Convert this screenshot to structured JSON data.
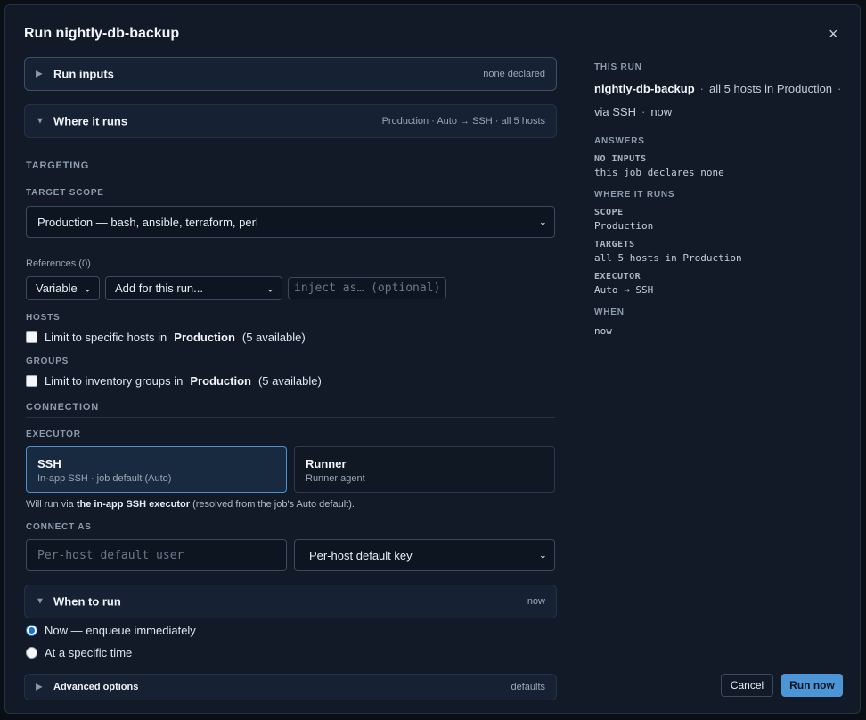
{
  "modal": {
    "title": "Run nightly-db-backup",
    "close_icon": "×"
  },
  "sections": {
    "run_inputs": {
      "label": "Run inputs",
      "meta": "none declared",
      "arrow": "▶"
    },
    "where_it_runs": {
      "label": "Where it runs",
      "meta": "Production · Auto → SSH · all 5 hosts",
      "arrow": "▼"
    },
    "when_to_run": {
      "label": "When to run",
      "meta": "now",
      "arrow": "▼"
    },
    "advanced": {
      "label": "Advanced options",
      "meta": "defaults",
      "arrow": "▶"
    }
  },
  "targeting": {
    "heading": "TARGETING",
    "scope_label": "TARGET SCOPE",
    "scope_value": "Production — bash, ansible, terraform, perl",
    "references_label": "References (0)",
    "ref_type": "Variable",
    "ref_add": "Add for this run...",
    "inject_placeholder": "inject as… (optional)",
    "hosts_label": "HOSTS",
    "hosts_check_prefix": "Limit to specific hosts in",
    "hosts_env": "Production",
    "hosts_count": "(5 available)",
    "groups_label": "GROUPS",
    "groups_check_prefix": "Limit to inventory groups in",
    "groups_env": "Production",
    "groups_count": "(5 available)"
  },
  "connection": {
    "heading": "CONNECTION",
    "executor_label": "EXECUTOR",
    "executors": [
      {
        "title": "SSH",
        "subtitle": "In-app SSH · job default (Auto)"
      },
      {
        "title": "Runner",
        "subtitle": "Runner agent"
      }
    ],
    "note_prefix": "Will run via",
    "note_bold": "the in-app SSH executor",
    "note_suffix": "(resolved from the job's Auto default).",
    "connect_as_label": "CONNECT AS",
    "user_placeholder": "Per-host default user",
    "key_value": "Per-host default key"
  },
  "when": {
    "options": [
      {
        "label": "Now — enqueue immediately",
        "selected": true
      },
      {
        "label": "At a specific time",
        "selected": false
      }
    ]
  },
  "summary": {
    "this_run_label": "THIS RUN",
    "job": "nightly-db-backup",
    "hosts_desc": "all 5 hosts in Production",
    "via": "via SSH",
    "when": "now",
    "sep": "·",
    "answers_label": "ANSWERS",
    "no_inputs_key": "NO INPUTS",
    "no_inputs_val": "this job declares none",
    "where_label": "WHERE IT RUNS",
    "scope_key": "SCOPE",
    "scope_val": "Production",
    "targets_key": "TARGETS",
    "targets_val": "all 5 hosts in Production",
    "executor_key": "EXECUTOR",
    "executor_val": "Auto → SSH",
    "when_key": "WHEN",
    "when_val": "now"
  },
  "footer": {
    "cancel": "Cancel",
    "run": "Run now"
  },
  "colors": {
    "accent": "#4c95d6",
    "panel": "#111a26",
    "selected_card": "#182a40"
  }
}
